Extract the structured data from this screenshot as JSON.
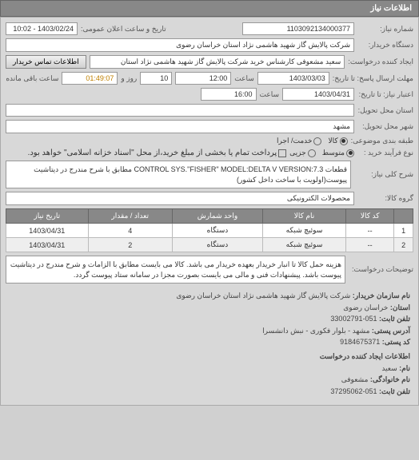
{
  "header": "اطلاعات نیاز",
  "rows": {
    "reqNo": {
      "label": "شماره نیاز:",
      "value": "1103092134000377"
    },
    "announce": {
      "label": "تاریخ و ساعت اعلان عمومی:",
      "value": "1403/02/24 - 10:02"
    },
    "buyer": {
      "label": "دستگاه خریدار:",
      "value": "شرکت پالایش گاز شهید هاشمی نژاد   استان خراسان رضوی"
    },
    "creator": {
      "label": "ایجاد کننده درخواست:",
      "value": "سعید مشعوفی کارشناس خرید شرکت پالایش گاز شهید هاشمی نژاد   استان"
    },
    "contactBtn": "اطلاعات تماس خریدار",
    "deadline": {
      "label": "مهلت ارسال پاسخ: تا تاریخ:",
      "date": "1403/03/03",
      "timeLbl": "ساعت",
      "time": "12:00",
      "daysVal": "10",
      "daysLbl": "روز و",
      "remain": "01:49:07",
      "remainLbl": "ساعت باقی مانده"
    },
    "validity": {
      "label": "اعتبار نیاز: تا تاریخ:",
      "date": "1403/04/31",
      "timeLbl": "ساعت",
      "time": "16:00"
    },
    "province": {
      "label": "استان محل تحویل:"
    },
    "city": {
      "label": "شهر محل تحویل:",
      "value": "مشهد"
    },
    "pkgType": {
      "label": "طبقه بندی موضوعی:",
      "options": [
        {
          "label": "کالا",
          "checked": true
        },
        {
          "label": "خدمت/ اجرا",
          "checked": false
        }
      ]
    },
    "buyType": {
      "label": "نوع فرآیند خرید :",
      "options": [
        {
          "label": "متوسط",
          "checked": true
        },
        {
          "label": "جزیی",
          "checked": false
        }
      ],
      "note": "پرداخت تمام یا بخشی از مبلغ خرید،از محل \"اسناد خزانه اسلامی\" خواهد بود.",
      "noteChecked": false
    },
    "mainDesc": {
      "label": "شرح کلی نیاز:",
      "value": "قطعات CONTROL SYS.\"FISHER\" MODEL:DELTA V VERSION:7.3 مطابق با شرح مندرج در دیتاشیت پیوست(اولویت با ساخت داخل کشور)"
    },
    "group": {
      "label": "گروه کالا:",
      "value": "محصولات الکترونیکی"
    }
  },
  "table": {
    "headers": [
      "",
      "کد کالا",
      "نام کالا",
      "واحد شمارش",
      "تعداد / مقدار",
      "تاریخ نیاز"
    ],
    "rows": [
      [
        "1",
        "--",
        "سوئیچ شبکه",
        "دستگاه",
        "4",
        "1403/04/31"
      ],
      [
        "2",
        "--",
        "سوئیچ شبکه",
        "دستگاه",
        "2",
        "1403/04/31"
      ]
    ]
  },
  "requestDesc": {
    "label": "توضیحات درخواست:",
    "value": "هزینه حمل کالا تا انبار خریدار بعهده خریدار می باشد. کالا می بایست مطابق با الزامات و شرح مندرج در دیتاشیت پیوست باشد. پیشنهادات فنی و مالی می بایست بصورت مجزا در سامانه ستاد پیوست گردد."
  },
  "footer": {
    "title": "اطلاعات ایجاد کننده درخواست",
    "orgLabel": "نام سازمان خریدار:",
    "org": "شرکت پالایش گاز شهید هاشمی نژاد استان خراسان رضوی",
    "provLabel": "استان:",
    "prov": "خراسان رضوی",
    "telLabel": "تلفن ثابت:",
    "tel": "051-33002791",
    "addrLabel": "آدرس پستی:",
    "addr": "مشهد - بلوار فکوری - نبش دانشسرا",
    "postLabel": "کد پستی:",
    "post": "9184675371",
    "creatorTitle": "اطلاعات ایجاد کننده درخواست",
    "nameLabel": "نام:",
    "name": "سعید",
    "lnameLabel": "نام خانوادگی:",
    "lname": "مشعوفی",
    "ctelLabel": "تلفن ثابت:",
    "ctel": "051-37295062"
  }
}
